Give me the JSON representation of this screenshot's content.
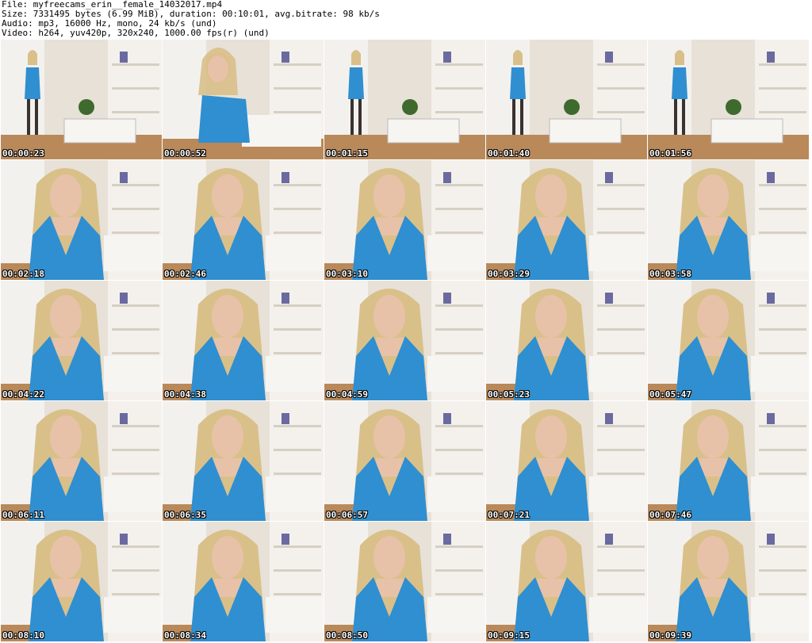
{
  "header": {
    "file": "File: myfreecams_erin__female_14032017.mp4",
    "size": "Size: 7331495 bytes (6.99 MiB), duration: 00:10:01, avg.bitrate: 98 kb/s",
    "audio": "Audio: mp3, 16000 Hz, mono, 24 kb/s (und)",
    "video": "Video: h264, yuv420p, 320x240, 1000.00 fps(r) (und)"
  },
  "thumbnails": [
    {
      "time": "00:00:23",
      "shot": "wide"
    },
    {
      "time": "00:00:52",
      "shot": "lean"
    },
    {
      "time": "00:01:15",
      "shot": "wide"
    },
    {
      "time": "00:01:40",
      "shot": "wide"
    },
    {
      "time": "00:01:56",
      "shot": "wide"
    },
    {
      "time": "00:02:18",
      "shot": "close"
    },
    {
      "time": "00:02:46",
      "shot": "close"
    },
    {
      "time": "00:03:10",
      "shot": "close"
    },
    {
      "time": "00:03:29",
      "shot": "close"
    },
    {
      "time": "00:03:58",
      "shot": "close"
    },
    {
      "time": "00:04:22",
      "shot": "close"
    },
    {
      "time": "00:04:38",
      "shot": "close"
    },
    {
      "time": "00:04:59",
      "shot": "close"
    },
    {
      "time": "00:05:23",
      "shot": "close"
    },
    {
      "time": "00:05:47",
      "shot": "close"
    },
    {
      "time": "00:06:11",
      "shot": "close"
    },
    {
      "time": "00:06:35",
      "shot": "close"
    },
    {
      "time": "00:06:57",
      "shot": "close"
    },
    {
      "time": "00:07:21",
      "shot": "close"
    },
    {
      "time": "00:07:46",
      "shot": "close"
    },
    {
      "time": "00:08:10",
      "shot": "close"
    },
    {
      "time": "00:08:34",
      "shot": "close"
    },
    {
      "time": "00:08:50",
      "shot": "close"
    },
    {
      "time": "00:09:15",
      "shot": "close"
    },
    {
      "time": "00:09:39",
      "shot": "close"
    }
  ],
  "colors": {
    "wall": "#e7e1d8",
    "shelf": "#f4f1ec",
    "floor": "#b9895a",
    "dress": "#2f8fd0",
    "hair": "#d9c089",
    "skin": "#e7c2a8",
    "timestamp": "#ffffff"
  }
}
